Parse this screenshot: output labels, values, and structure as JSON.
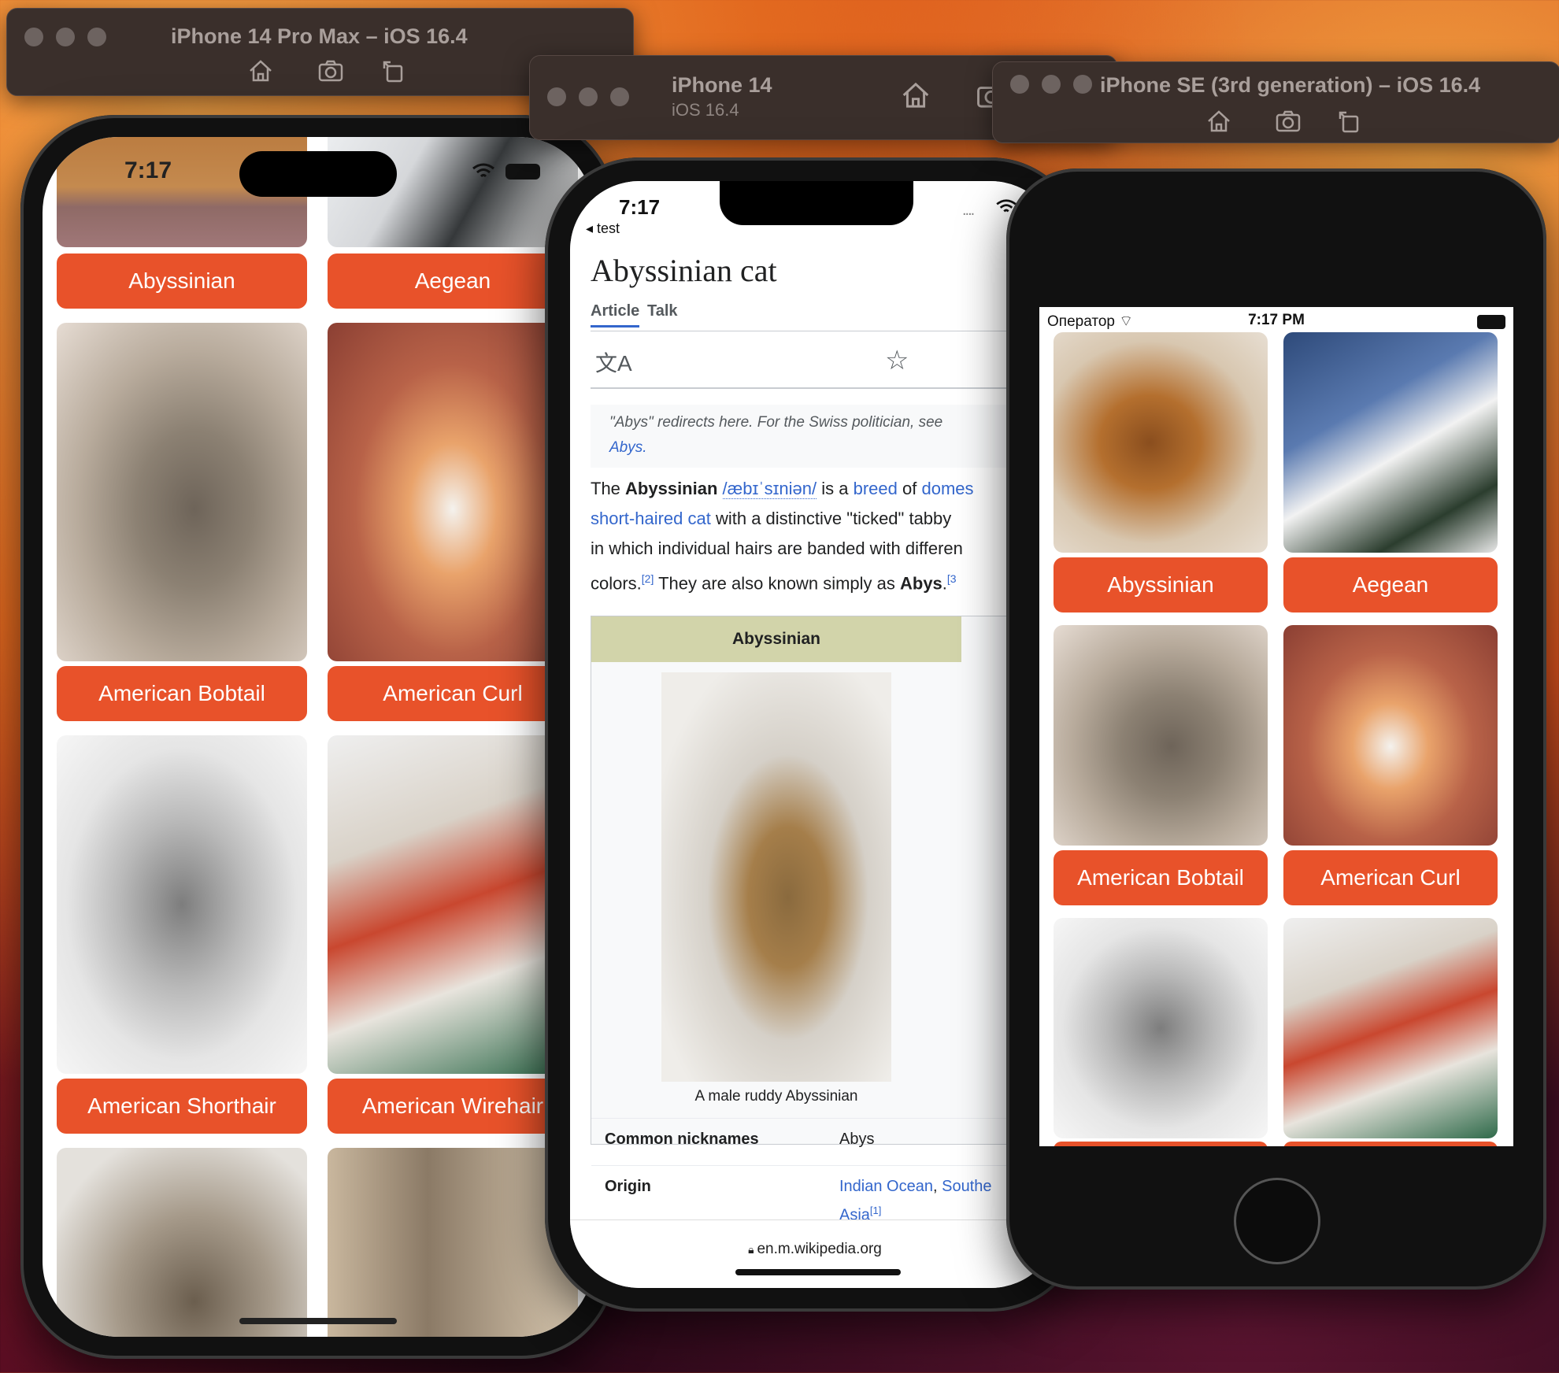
{
  "windows": {
    "w1": {
      "title": "iPhone 14 Pro Max – iOS 16.4"
    },
    "w2": {
      "title": "iPhone 14",
      "subtitle": "iOS 16.4"
    },
    "w3": {
      "title": "iPhone SE (3rd generation) – iOS 16.4"
    }
  },
  "p1": {
    "time": "7:17",
    "breeds": [
      "Abyssinian",
      "Aegean",
      "American Bobtail",
      "American Curl",
      "American Shorthair",
      "American Wirehair"
    ]
  },
  "p2": {
    "time": "7:17",
    "back": "◂ test",
    "page_title": "Abyssinian cat",
    "tabs": [
      "Article",
      "Talk"
    ],
    "hatnote_a": "\"Abys\" redirects here. For the Swiss politician, see",
    "hatnote_b": "Abys.",
    "intro": {
      "t1": "The ",
      "b1": "Abyssinian",
      "t2": " ",
      "ipa": "/æbɪˈsɪniən/",
      "t3": " is a ",
      "l1": "breed",
      "t4": " of ",
      "l2": "domes",
      "l3": "short-haired cat",
      "t5": " with a distinctive \"ticked\" tabby",
      "t6": "in which individual hairs are banded with differen",
      "t7": "colors.",
      "ref2": "[2]",
      "t8": " They are also known simply as ",
      "b2": "Abys",
      "t9": ".",
      "ref3": "[3"
    },
    "infobox": {
      "title": "Abyssinian",
      "caption": "A male ruddy Abyssinian",
      "rows": [
        {
          "label": "Common nicknames",
          "value": "Abys"
        },
        {
          "label": "Origin",
          "value_a": "Indian Ocean",
          "value_b": ", ",
          "value_c": "Southe",
          "value_d": "Asia",
          "value_ref": "[1]"
        }
      ]
    },
    "url": "en.m.wikipedia.org"
  },
  "p3": {
    "carrier": "Оператор",
    "time": "7:17 PM",
    "breeds": [
      "Abyssinian",
      "Aegean",
      "American Bobtail",
      "American Curl"
    ]
  },
  "colors": {
    "accent": "#e8522a",
    "link": "#3366cc",
    "infobox_header": "#d2d4aa"
  }
}
